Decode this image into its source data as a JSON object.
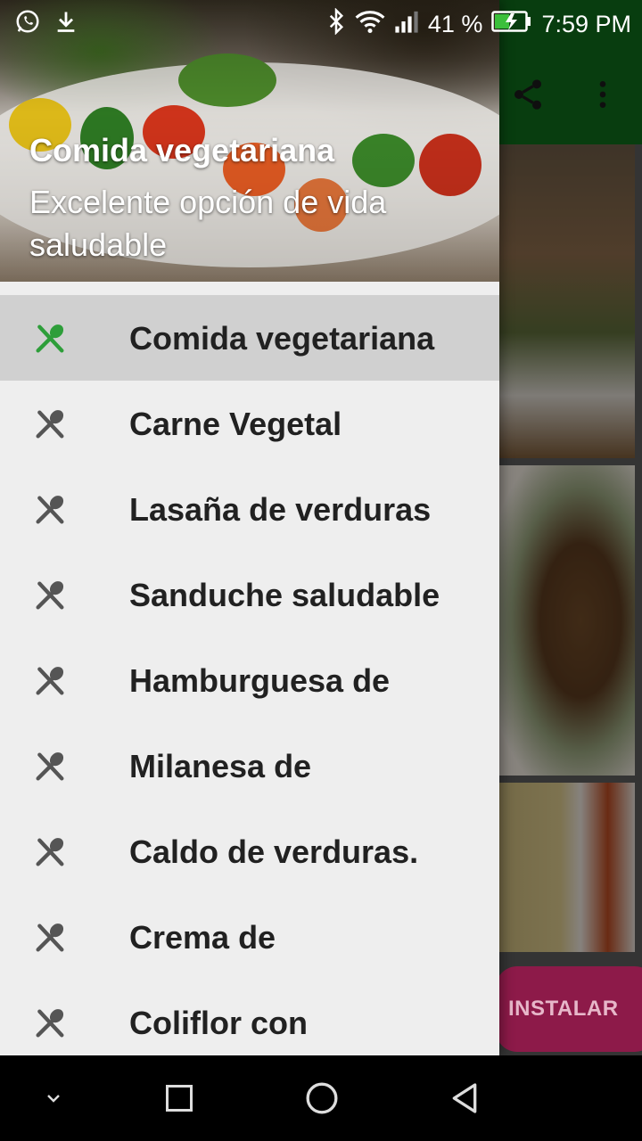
{
  "status_bar": {
    "battery_percent": "41 %",
    "time": "7:59 PM",
    "icons": [
      "whatsapp-icon",
      "download-icon",
      "bluetooth-icon",
      "wifi-icon",
      "signal-icon",
      "battery-charging-icon"
    ]
  },
  "app_bar": {
    "actions": [
      "share-icon",
      "more-vert-icon"
    ],
    "color": "#0f6a1a"
  },
  "ad": {
    "install_label": "INSTALAR"
  },
  "drawer": {
    "header": {
      "title": "Comida vegetariana",
      "subtitle": "Excelente opción de vida saludable"
    },
    "items": [
      {
        "label": "Comida vegetariana",
        "icon": "utensils-icon",
        "active": true
      },
      {
        "label": "Carne Vegetal",
        "icon": "utensils-icon",
        "active": false
      },
      {
        "label": "Lasaña de verduras",
        "icon": "utensils-icon",
        "active": false
      },
      {
        "label": "Sanduche saludable",
        "icon": "utensils-icon",
        "active": false
      },
      {
        "label": "Hamburguesa de",
        "icon": "utensils-icon",
        "active": false
      },
      {
        "label": "Milanesa de",
        "icon": "utensils-icon",
        "active": false
      },
      {
        "label": "Caldo de verduras.",
        "icon": "utensils-icon",
        "active": false
      },
      {
        "label": "Crema de",
        "icon": "utensils-icon",
        "active": false
      },
      {
        "label": "Coliflor con",
        "icon": "utensils-icon",
        "active": false
      }
    ],
    "active_color": "#2e9e3a",
    "icon_color": "#555555"
  },
  "nav_bar": {
    "buttons": [
      "collapse-icon",
      "recents-icon",
      "home-icon",
      "back-icon"
    ]
  }
}
